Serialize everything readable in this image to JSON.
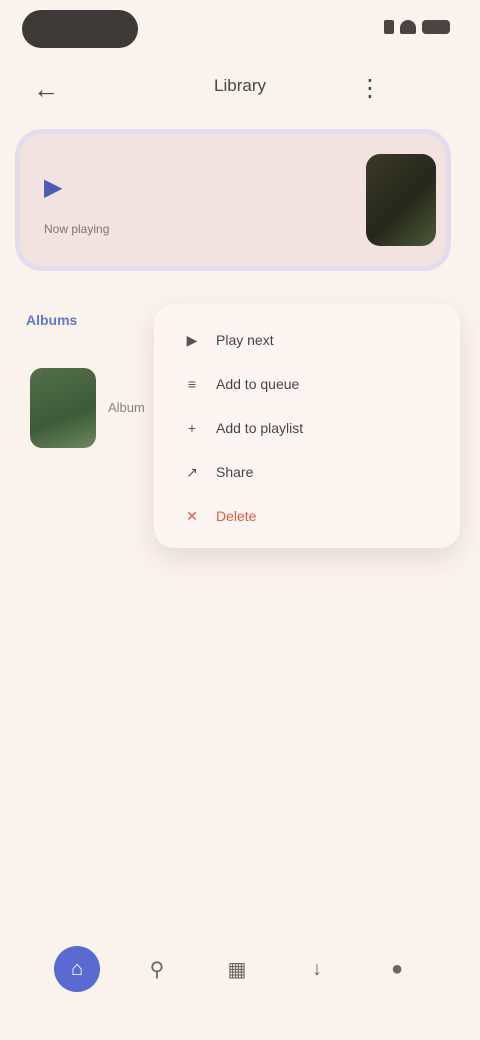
{
  "top_bar": {
    "title": "Library",
    "back_icon": "arrow-back-icon",
    "more_icon": "more-vert-icon"
  },
  "now_playing": {
    "play_icon": "play-icon",
    "subtitle": "Now playing"
  },
  "section": {
    "label": "Albums"
  },
  "album": {
    "title": "Album"
  },
  "menu": {
    "items": [
      {
        "icon": "play-icon",
        "label": "Play next"
      },
      {
        "icon": "queue-icon",
        "label": "Add to queue"
      },
      {
        "icon": "playlist-add-icon",
        "label": "Add to playlist"
      },
      {
        "icon": "share-icon",
        "label": "Share"
      },
      {
        "icon": "delete-icon",
        "label": "Delete"
      }
    ]
  },
  "bottom_nav": {
    "items": [
      {
        "icon": "home-icon",
        "active": true
      },
      {
        "icon": "search-icon",
        "active": false
      },
      {
        "icon": "library-icon",
        "active": false
      },
      {
        "icon": "download-icon",
        "active": false
      },
      {
        "icon": "profile-icon",
        "active": false
      }
    ]
  },
  "colors": {
    "background": "#faf2ec",
    "accent": "#5a6ad0",
    "danger": "#e05a4a"
  }
}
